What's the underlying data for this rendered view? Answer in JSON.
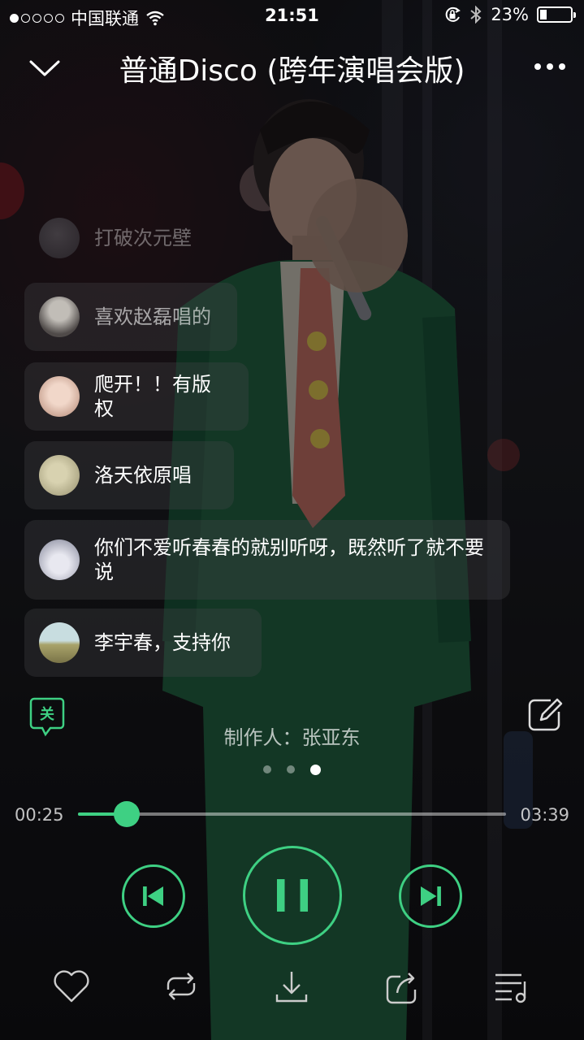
{
  "status_bar": {
    "signal_dots": 5,
    "signal_active": 1,
    "carrier": "中国联通",
    "time": "21:51",
    "battery_percent": "23%",
    "battery_level": 0.23,
    "icons": [
      "wifi-icon",
      "rotation-lock-icon",
      "bluetooth-icon",
      "battery-icon"
    ]
  },
  "header": {
    "title": "普通Disco (跨年演唱会版)",
    "icons": [
      "chevron-down-icon",
      "more-icon"
    ]
  },
  "comments": [
    {
      "text": "打破次元壁"
    },
    {
      "text": "喜欢赵磊唱的"
    },
    {
      "text": "爬开！！有版权"
    },
    {
      "text": " 洛天依原唱"
    },
    {
      "text": "你们不爱听春春的就别听呀，既然听了就不要说"
    },
    {
      "text": "李宇春，支持你"
    }
  ],
  "danmu_toggle": {
    "label": "关"
  },
  "producer": "制作人：张亚东",
  "pager": {
    "count": 3,
    "active": 3
  },
  "progress": {
    "current": "00:25",
    "total": "03:39",
    "fraction": 0.114
  },
  "controls": {
    "icons": [
      "previous-icon",
      "pause-icon",
      "next-icon"
    ],
    "accent": "#3ed083"
  },
  "bottom_bar": {
    "icons": [
      "heart-icon",
      "repeat-icon",
      "download-icon",
      "share-icon",
      "playlist-icon"
    ]
  }
}
